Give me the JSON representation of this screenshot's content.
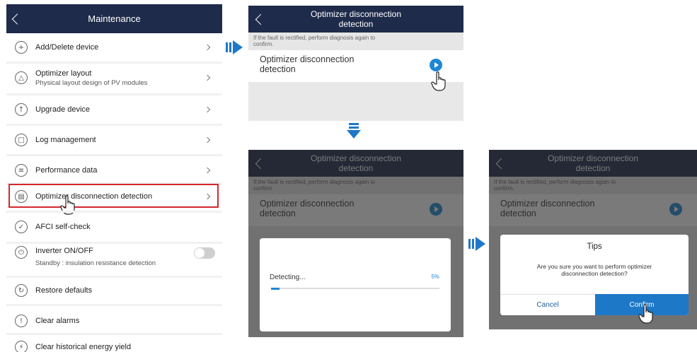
{
  "maintenance": {
    "title": "Maintenance",
    "items": [
      {
        "label": "Add/Delete device",
        "icon": "add-circle-icon"
      },
      {
        "label": "Optimizer layout",
        "sub": "Physical layout design of PV modules",
        "icon": "layout-icon"
      },
      {
        "label": "Upgrade device",
        "icon": "upgrade-icon"
      },
      {
        "label": "Log management",
        "icon": "log-icon"
      },
      {
        "label": "Performance data",
        "icon": "performance-icon"
      },
      {
        "label": "Optimizer disconnection detection",
        "icon": "optimizer-icon"
      },
      {
        "label": "AFCI self-check",
        "icon": "afci-icon"
      },
      {
        "label": "Inverter ON/OFF",
        "sub": "Standby : insulation resistance detection",
        "icon": "power-icon"
      },
      {
        "label": "Restore defaults",
        "icon": "restore-icon"
      },
      {
        "label": "Clear alarms",
        "icon": "alarm-icon"
      },
      {
        "label": "Clear historical energy yield",
        "icon": "energy-icon"
      }
    ],
    "inverter_toggle": "off"
  },
  "detection": {
    "title_line1": "Optimizer disconnection",
    "title_line2": "detection",
    "hint_line1": "If the fault is rectified, perform diagnosis again to",
    "hint_line2": "confirm.",
    "row_line1": "Optimizer disconnection",
    "row_line2": "detection"
  },
  "progress": {
    "label": "Detecting...",
    "percent_text": "5%",
    "percent": 5
  },
  "tips": {
    "title": "Tips",
    "message_line1": "Are you sure you want to perform optimizer",
    "message_line2": "disconnection detection?",
    "cancel": "Cancel",
    "confirm": "Confirm"
  },
  "colors": {
    "nav": "#1e2b4a",
    "accent": "#1e78c8",
    "highlight": "#d6282c"
  }
}
